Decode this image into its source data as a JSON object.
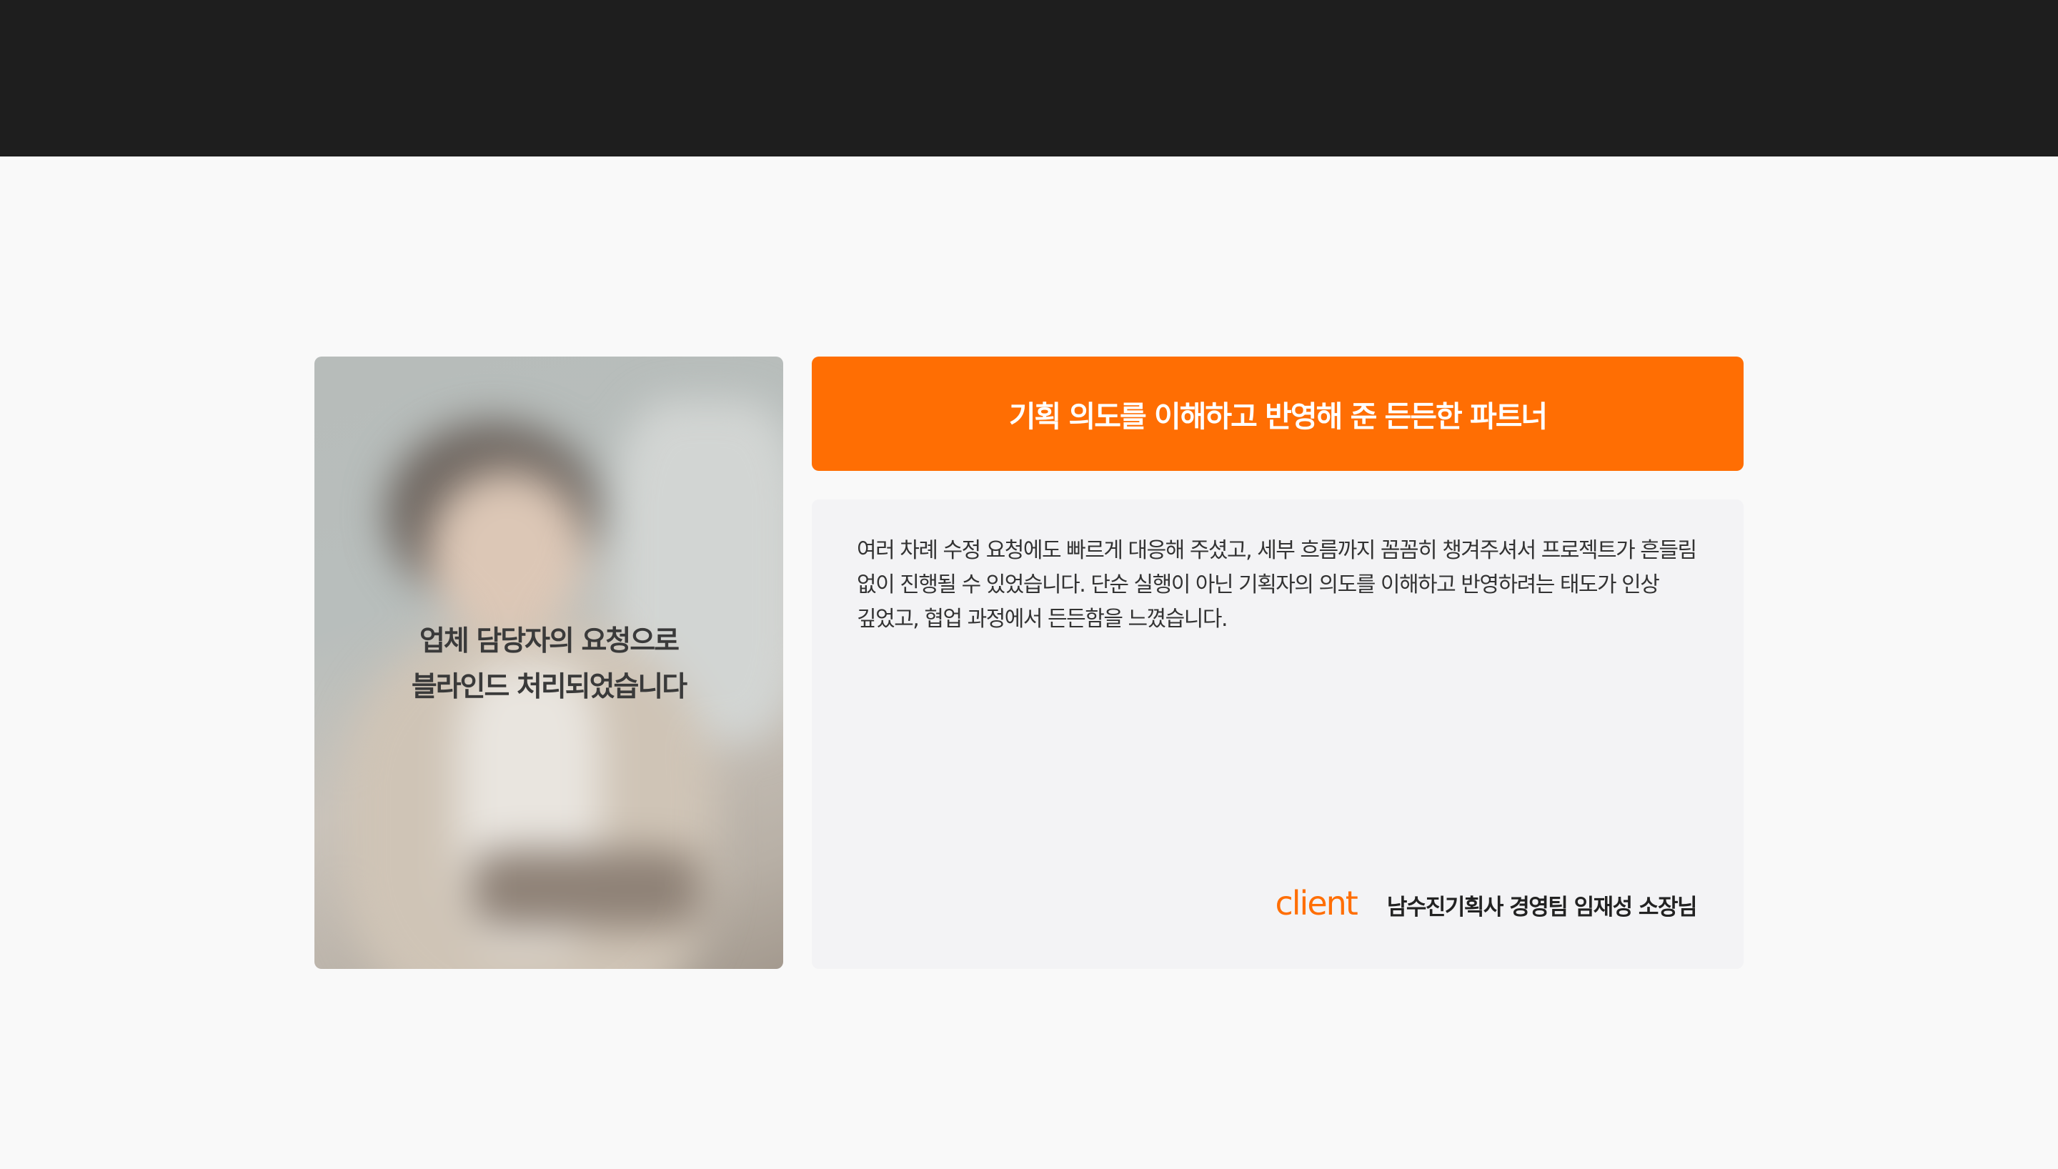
{
  "testimonial": {
    "photo_notice_line1": "업체 담당자의 요청으로",
    "photo_notice_line2": "블라인드 처리되었습니다",
    "headline": "기획 의도를 이해하고 반영해 준 든든한 파트너",
    "body": "여러 차례 수정 요청에도 빠르게 대응해 주셨고, 세부 흐름까지 꼼꼼히 챙겨주셔서 프로젝트가 흔들림 없이 진행될 수 있었습니다. 단순 실행이 아닌 기획자의 의도를 이해하고 반영하려는 태도가 인상 깊었고, 협업 과정에서 든든함을 느꼈습니다.",
    "client_label": "client",
    "client_name": "남수진기획사 경영팀 임재성 소장님"
  },
  "colors": {
    "accent": "#ff6e03",
    "top_bar": "#1e1e1e",
    "page_background": "#f9f9f9",
    "card_background": "#f3f3f5"
  }
}
